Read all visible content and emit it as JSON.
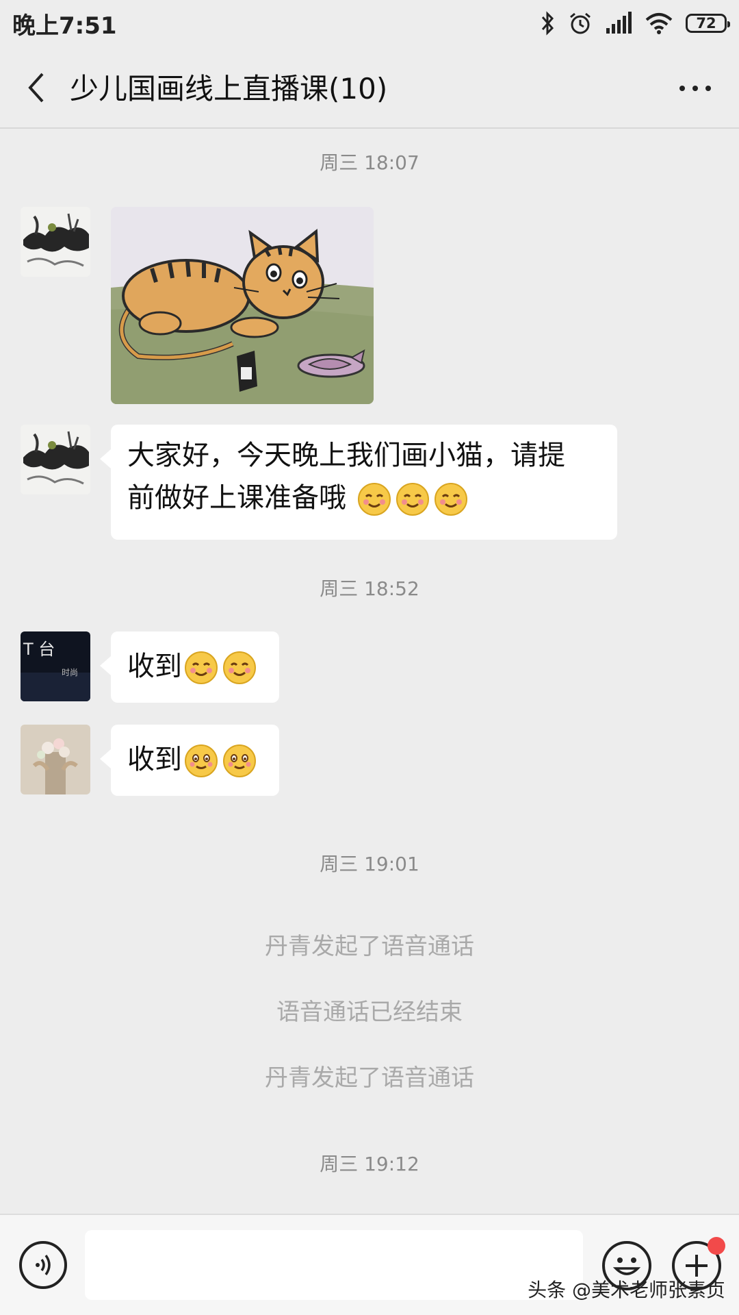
{
  "status_bar": {
    "time": "晚上7:51",
    "battery": "72"
  },
  "header": {
    "title": "少儿国画线上直播课(10)"
  },
  "messages": {
    "ts1": "周三 18:07",
    "text1_line1": "大家好，今天晚上我们画小猫，请提",
    "text1_line2": "前做好上课准备哦",
    "ts2": "周三 18:52",
    "reply1": "收到",
    "reply2": "收到",
    "ts3": "周三 19:01",
    "sys1": "丹青发起了语音通话",
    "sys2": "语音通话已经结束",
    "sys3": "丹青发起了语音通话",
    "ts4": "周三 19:12"
  },
  "input": {
    "placeholder": ""
  },
  "watermark": "头条 @美术老师张素贞"
}
